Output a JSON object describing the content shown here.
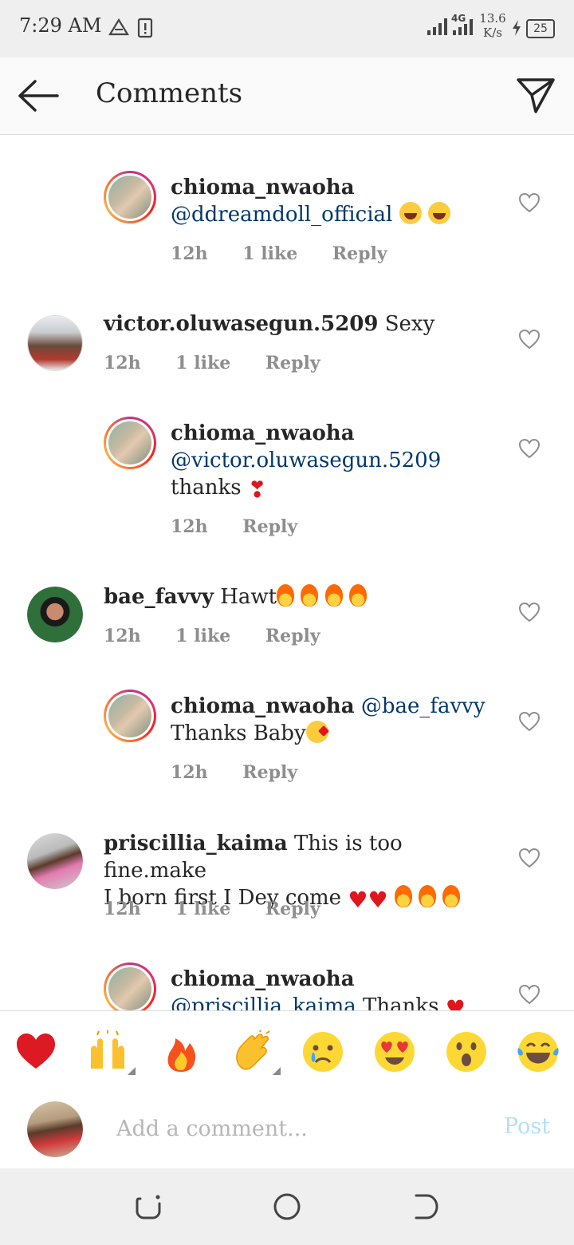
{
  "status_bar": {
    "time": "7:29 AM",
    "network": "4G",
    "speed_value": "13.6",
    "speed_unit": "K/s",
    "battery": "25"
  },
  "header": {
    "title": "Comments"
  },
  "comments": [
    {
      "username": "chioma_nwaoha",
      "mention": "@ddreamdoll_official",
      "text": "",
      "emojis": [
        "laugh-emoji",
        "laugh-emoji"
      ],
      "time": "12h",
      "likes": "1 like",
      "reply": "Reply",
      "is_reply": true
    },
    {
      "username": "victor.oluwasegun.5209",
      "text": "Sexy",
      "time": "12h",
      "likes": "1 like",
      "reply": "Reply",
      "is_reply": false
    },
    {
      "username": "chioma_nwaoha",
      "mention": "@victor.oluwasegun.5209",
      "text": "thanks",
      "emojis": [
        "heart-exclamation-emoji"
      ],
      "time": "12h",
      "reply": "Reply",
      "is_reply": true
    },
    {
      "username": "bae_favvy",
      "text": "Hawt",
      "emojis": [
        "fire-emoji",
        "fire-emoji",
        "fire-emoji",
        "fire-emoji"
      ],
      "time": "12h",
      "likes": "1 like",
      "reply": "Reply",
      "is_reply": false
    },
    {
      "username": "chioma_nwaoha",
      "mention": "@bae_favvy",
      "text": "Thanks Baby",
      "emojis": [
        "kiss-emoji"
      ],
      "time": "12h",
      "reply": "Reply",
      "is_reply": true
    },
    {
      "username": "priscillia_kaima",
      "text_line1": "This is too fine.make",
      "text_line2": "I born first I Dey come",
      "emojis": [
        "heart-emoji",
        "heart-emoji",
        "fire-emoji",
        "fire-emoji",
        "fire-emoji"
      ],
      "time": "12h",
      "likes": "1 like",
      "reply": "Reply",
      "is_reply": false
    },
    {
      "username": "chioma_nwaoha",
      "mention": "@priscillia_kaima",
      "text": "Thanks",
      "emojis": [
        "heart-emoji"
      ],
      "is_reply": true
    }
  ],
  "emoji_bar": [
    "red-heart",
    "raising-hands",
    "fire",
    "clapping-hands",
    "crying-face",
    "heart-eyes",
    "surprised-face",
    "tears-of-joy"
  ],
  "composer": {
    "placeholder": "Add a comment...",
    "post_label": "Post"
  },
  "colors": {
    "mention": "#00376b",
    "meta": "#8e8e8e",
    "post_disabled": "#b2dffc",
    "divider": "#dbdbdb"
  }
}
